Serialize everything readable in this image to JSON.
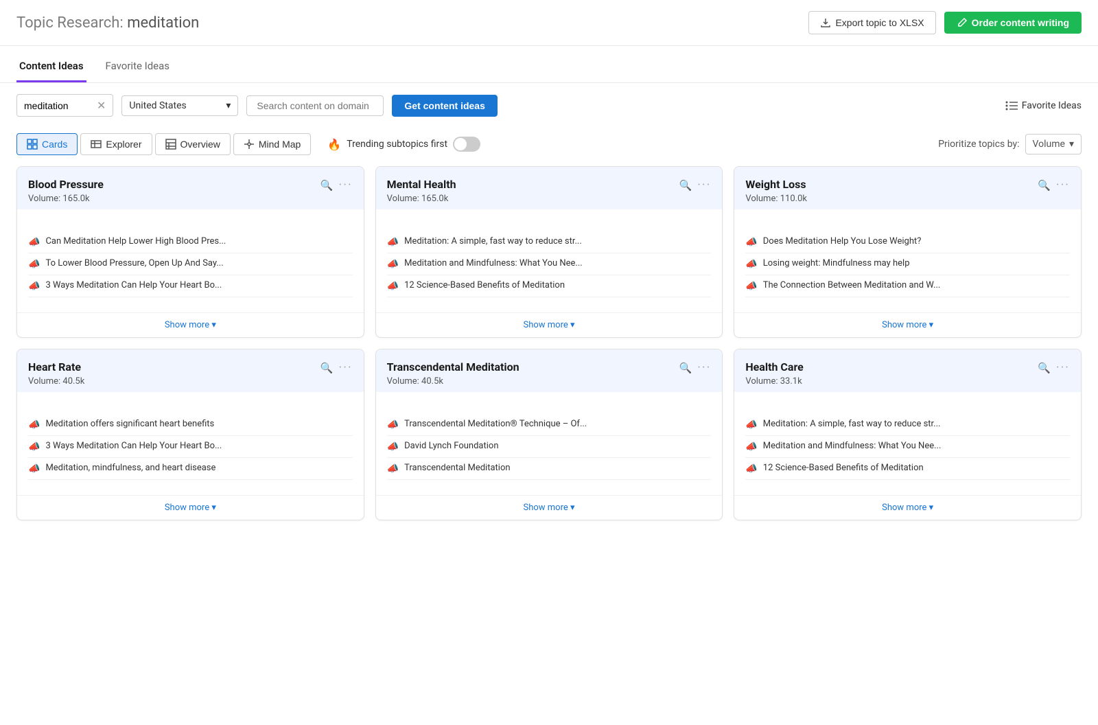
{
  "header": {
    "title": "Topic Research:",
    "topic": "meditation",
    "export_label": "Export topic to XLSX",
    "order_label": "Order content writing"
  },
  "tabs": [
    {
      "id": "content-ideas",
      "label": "Content Ideas",
      "active": true
    },
    {
      "id": "favorite-ideas",
      "label": "Favorite Ideas",
      "active": false
    }
  ],
  "toolbar": {
    "search_value": "meditation",
    "country_value": "United States",
    "domain_placeholder": "Search content on domain",
    "get_ideas_label": "Get content ideas",
    "favorite_label": "Favorite Ideas"
  },
  "view_toolbar": {
    "views": [
      {
        "id": "cards",
        "label": "Cards",
        "active": true
      },
      {
        "id": "explorer",
        "label": "Explorer",
        "active": false
      },
      {
        "id": "overview",
        "label": "Overview",
        "active": false
      },
      {
        "id": "mind-map",
        "label": "Mind Map",
        "active": false
      }
    ],
    "trending_label": "Trending subtopics first",
    "trending_on": false,
    "priority_label": "Prioritize topics by:",
    "priority_value": "Volume"
  },
  "cards": [
    {
      "id": "blood-pressure",
      "title": "Blood Pressure",
      "volume": "Volume: 165.0k",
      "items": [
        "Can Meditation Help Lower High Blood Pres...",
        "To Lower Blood Pressure, Open Up And Say...",
        "3 Ways Meditation Can Help Your Heart Bo..."
      ],
      "show_more": "Show more"
    },
    {
      "id": "mental-health",
      "title": "Mental Health",
      "volume": "Volume: 165.0k",
      "items": [
        "Meditation: A simple, fast way to reduce str...",
        "Meditation and Mindfulness: What You Nee...",
        "12 Science-Based Benefits of Meditation"
      ],
      "show_more": "Show more"
    },
    {
      "id": "weight-loss",
      "title": "Weight Loss",
      "volume": "Volume: 110.0k",
      "items": [
        "Does Meditation Help You Lose Weight?",
        "Losing weight: Mindfulness may help",
        "The Connection Between Meditation and W..."
      ],
      "show_more": "Show more"
    },
    {
      "id": "heart-rate",
      "title": "Heart Rate",
      "volume": "Volume: 40.5k",
      "items": [
        "Meditation offers significant heart benefits",
        "3 Ways Meditation Can Help Your Heart Bo...",
        "Meditation, mindfulness, and heart disease"
      ],
      "show_more": "Show more"
    },
    {
      "id": "transcendental-meditation",
      "title": "Transcendental Meditation",
      "volume": "Volume: 40.5k",
      "items": [
        "Transcendental Meditation® Technique – Of...",
        "David Lynch Foundation",
        "Transcendental Meditation"
      ],
      "show_more": "Show more"
    },
    {
      "id": "health-care",
      "title": "Health Care",
      "volume": "Volume: 33.1k",
      "items": [
        "Meditation: A simple, fast way to reduce str...",
        "Meditation and Mindfulness: What You Nee...",
        "12 Science-Based Benefits of Meditation"
      ],
      "show_more": "Show more"
    }
  ]
}
